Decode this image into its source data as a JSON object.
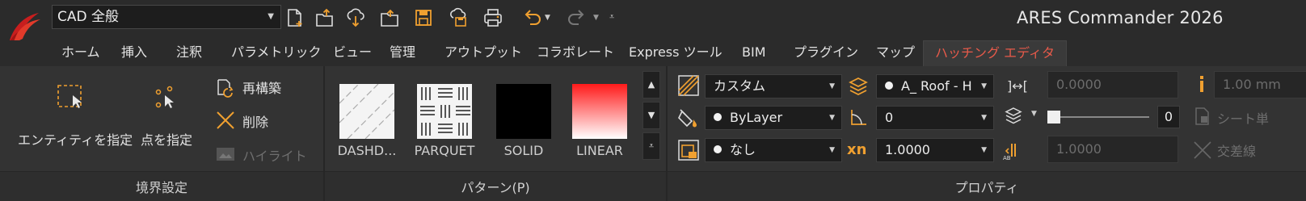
{
  "titlebar": {
    "workspace": "CAD 全般",
    "app_title": "ARES Commander 2026"
  },
  "tabs": [
    "ホーム",
    "挿入",
    "注釈",
    "パラメトリック",
    "ビュー",
    "管理",
    "アウトプット",
    "コラボレート",
    "Express ツール",
    "BIM",
    "プラグイン",
    "マップ",
    "ハッチング エディタ"
  ],
  "active_tab": "ハッチング エディタ",
  "boundary": {
    "specify_entity": "エンティティを指定",
    "specify_point": "点を指定",
    "rebuild": "再構築",
    "delete": "削除",
    "highlight": "ハイライト",
    "panel_label": "境界設定"
  },
  "pattern": {
    "swatches": [
      "DASHD...",
      "PARQUET",
      "SOLID",
      "LINEAR"
    ],
    "panel_label": "パターン(P)"
  },
  "properties": {
    "type": "カスタム",
    "layer": "A_ Roof - H",
    "spacing_value": "0.0000",
    "lineweight_value": "1.00 mm",
    "color": "ByLayer",
    "angle": "0",
    "transparency": "0",
    "detached_label": "シート単",
    "background": "なし",
    "scale": "1.0000",
    "iso_value": "1.0000",
    "cross_label": "交差線",
    "panel_label": "プロパティ"
  },
  "colors": {
    "accent": "#e85a4a",
    "ribbon_bg": "#333333",
    "titlebar_bg": "#2b2b2b",
    "orange_icon": "#f0a030"
  }
}
